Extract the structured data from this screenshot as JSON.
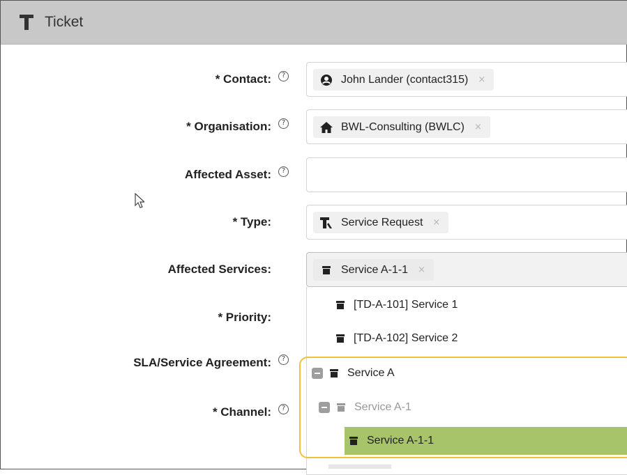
{
  "header": {
    "title": "Ticket",
    "icon": "ticket-type-icon"
  },
  "form": {
    "contact": {
      "label": "* Contact:",
      "value": "John Lander (contact315)",
      "icon": "person-icon"
    },
    "organisation": {
      "label": "* Organisation:",
      "value": "BWL-Consulting (BWLC)",
      "icon": "organisation-icon"
    },
    "affected_asset": {
      "label": "Affected Asset:",
      "value": ""
    },
    "type": {
      "label": "* Type:",
      "value": "Service Request",
      "icon": "ticket-type-icon"
    },
    "affected_services": {
      "label": "Affected Services:",
      "value": "Service A-1-1",
      "icon": "service-icon"
    },
    "priority": {
      "label": "* Priority:"
    },
    "sla": {
      "label": "SLA/Service Agreement:"
    },
    "channel": {
      "label": "* Channel:"
    },
    "remove_symbol": "×",
    "help_symbol": "?"
  },
  "dropdown": {
    "items": [
      {
        "label": "[TD-A-101] Service 1",
        "level": 0,
        "state": "normal"
      },
      {
        "label": "[TD-A-102] Service 2",
        "level": 0,
        "state": "normal"
      },
      {
        "label": "Service A",
        "level": 0,
        "state": "expanded"
      },
      {
        "label": "Service A-1",
        "level": 1,
        "state": "expanded-disabled"
      },
      {
        "label": "Service A-1-1",
        "level": 2,
        "state": "selected"
      }
    ]
  },
  "colors": {
    "header_bg": "#c8c8c8",
    "selected_bg": "#a7c46a",
    "highlight_border": "#efc13a"
  }
}
